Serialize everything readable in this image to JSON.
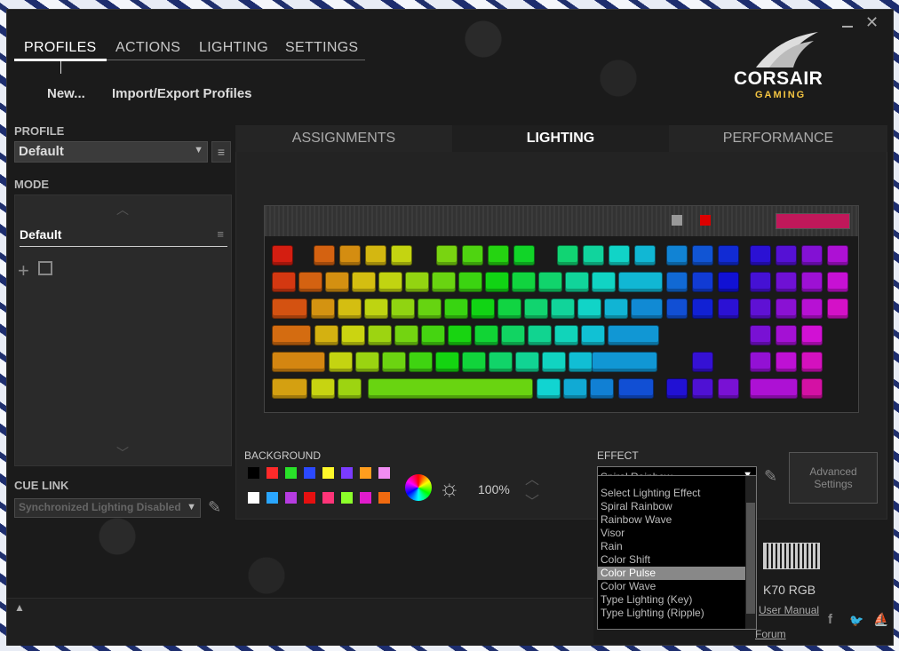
{
  "window": {
    "minimize_icon": "minimize-icon",
    "close_icon": "close-icon"
  },
  "nav": {
    "tabs": [
      "PROFILES",
      "ACTIONS",
      "LIGHTING",
      "SETTINGS"
    ],
    "active": "PROFILES"
  },
  "links": {
    "new": "New...",
    "import_export": "Import/Export Profiles"
  },
  "brand": {
    "name": "CORSAIR",
    "sub": "GAMING",
    "accent": "#f4c542"
  },
  "profile": {
    "label": "PROFILE",
    "value": "Default"
  },
  "mode": {
    "label": "MODE",
    "items": [
      "Default"
    ]
  },
  "cue_link": {
    "label": "CUE LINK",
    "value": "Synchronized Lighting Disabled"
  },
  "subtabs": [
    "ASSIGNMENTS",
    "LIGHTING",
    "PERFORMANCE"
  ],
  "subtab_active": "LIGHTING",
  "background": {
    "label": "BACKGROUND",
    "brightness": "100%",
    "colors_row1": [
      "#000000",
      "#ff2a2a",
      "#29e229",
      "#2b49ff",
      "#fff82a",
      "#7b3bff",
      "#ff9d1e",
      "#f08cf2"
    ],
    "colors_row2": [
      "#ffffff",
      "#2aa6ff",
      "#b63ce0",
      "#e61010",
      "#ff3478",
      "#8cff2a",
      "#e01ccb",
      "#f06a10"
    ]
  },
  "effect": {
    "label": "EFFECT",
    "selected": "Spiral Rainbow",
    "options": [
      "Select Lighting Effect",
      "Spiral Rainbow",
      "Rainbow Wave",
      "Visor",
      "Rain",
      "Color Shift",
      "Color Pulse",
      "Color Wave",
      "Type Lighting (Key)",
      "Type Lighting (Ripple)"
    ],
    "highlighted": "Color Pulse"
  },
  "advanced_settings": "Advanced Settings",
  "device": {
    "name": "K70 RGB",
    "user_manual": "User Manual",
    "forum": "Forum"
  }
}
